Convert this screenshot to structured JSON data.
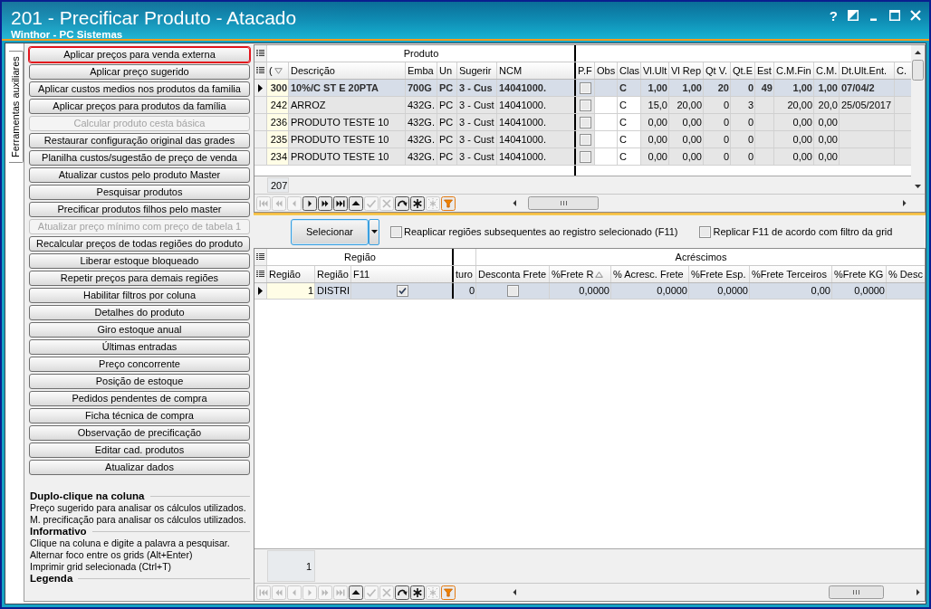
{
  "window": {
    "title": "201 - Precificar Produto - Atacado",
    "subtitle": "Winthor - PC Sistemas",
    "help_label": "?"
  },
  "side_tabs": [
    {
      "label": "Ferramentas auxiliares",
      "selected": true
    }
  ],
  "tool_buttons": [
    {
      "label": "Aplicar preços para venda externa",
      "disabled": false,
      "highlighted": true
    },
    {
      "label": "Aplicar preço sugerido",
      "disabled": false,
      "highlighted": false
    },
    {
      "label": "Aplicar custos medios nos produtos da familia",
      "disabled": false,
      "highlighted": false
    },
    {
      "label": "Aplicar preços para produtos da família",
      "disabled": false,
      "highlighted": false
    },
    {
      "label": "Calcular produto cesta básica",
      "disabled": true,
      "highlighted": false
    },
    {
      "label": "Restaurar configuração original das grades",
      "disabled": false,
      "highlighted": false
    },
    {
      "label": "Planilha custos/sugestão de preço de venda",
      "disabled": false,
      "highlighted": false
    },
    {
      "label": "Atualizar custos pelo produto Master",
      "disabled": false,
      "highlighted": false
    },
    {
      "label": "Pesquisar produtos",
      "disabled": false,
      "highlighted": false
    },
    {
      "label": "Precificar produtos filhos pelo master",
      "disabled": false,
      "highlighted": false
    },
    {
      "label": "Atualizar preço mínimo com preço de tabela 1",
      "disabled": true,
      "highlighted": false
    },
    {
      "label": "Recalcular preços de todas regiões do produto",
      "disabled": false,
      "highlighted": false
    },
    {
      "label": "Liberar estoque bloqueado",
      "disabled": false,
      "highlighted": false
    },
    {
      "label": "Repetir preços para demais regiões",
      "disabled": false,
      "highlighted": false
    },
    {
      "label": "Habilitar filtros por coluna",
      "disabled": false,
      "highlighted": false
    },
    {
      "label": "Detalhes do produto",
      "disabled": false,
      "highlighted": false
    },
    {
      "label": "Giro estoque anual",
      "disabled": false,
      "highlighted": false
    },
    {
      "label": "Últimas entradas",
      "disabled": false,
      "highlighted": false
    },
    {
      "label": "Preço concorrente",
      "disabled": false,
      "highlighted": false
    },
    {
      "label": "Posição de estoque",
      "disabled": false,
      "highlighted": false
    },
    {
      "label": "Pedidos pendentes de compra",
      "disabled": false,
      "highlighted": false
    },
    {
      "label": "Ficha técnica de compra",
      "disabled": false,
      "highlighted": false
    },
    {
      "label": "Observação de precificação",
      "disabled": false,
      "highlighted": false
    },
    {
      "label": "Editar cad. produtos",
      "disabled": false,
      "highlighted": false
    },
    {
      "label": "Atualizar dados",
      "disabled": false,
      "highlighted": false
    }
  ],
  "help_sections": [
    {
      "title": "Duplo-clique na coluna",
      "lines": [
        "Preço sugerido para analisar os cálculos utilizados.",
        "M. precificação para analisar os cálculos utilizados."
      ]
    },
    {
      "title": "Informativo",
      "lines": [
        "Clique na coluna e digite a palavra a pesquisar.",
        "Alternar foco entre os grids (Alt+Enter)",
        "Imprimir grid selecionada (Ctrl+T)"
      ]
    },
    {
      "title": "Legenda"
    }
  ],
  "product_grid": {
    "bands": [
      "Produto"
    ],
    "columns": [
      {
        "label": "(",
        "kind": "code",
        "sorted_desc": true,
        "editable": false
      },
      {
        "label": "Descrição",
        "kind": "text",
        "editable": false
      },
      {
        "label": "Emba",
        "kind": "text",
        "editable": false
      },
      {
        "label": "Un",
        "kind": "text",
        "editable": false
      },
      {
        "label": "Sugerir",
        "kind": "text",
        "editable": false
      },
      {
        "label": "NCM",
        "kind": "text",
        "editable": false
      },
      {
        "label": "P.F",
        "kind": "check",
        "editable": false
      },
      {
        "label": "Obs",
        "kind": "text",
        "editable": true
      },
      {
        "label": "Clas",
        "kind": "text",
        "editable": true
      },
      {
        "label": "Vl.Ult",
        "kind": "number",
        "editable": false
      },
      {
        "label": "Vl Rep",
        "kind": "number",
        "editable": false
      },
      {
        "label": "Qt V.",
        "kind": "number",
        "editable": false
      },
      {
        "label": "Qt.E",
        "kind": "number",
        "editable": false
      },
      {
        "label": "Est",
        "kind": "number",
        "editable": false
      },
      {
        "label": "C.M.Fin",
        "kind": "number",
        "editable": false
      },
      {
        "label": "C.M.",
        "kind": "number",
        "editable": false
      },
      {
        "label": "Dt.Ult.Ent.",
        "kind": "text",
        "editable": false
      },
      {
        "label": "C.",
        "kind": "text",
        "editable": false
      }
    ],
    "rows": [
      {
        "selected": true,
        "bold": true,
        "cells": [
          "300",
          "10%/C ST E 20PTA",
          "700G",
          "PC",
          "3 - Cus",
          "14041000.",
          {
            "checked": false
          },
          null,
          "C",
          "1,00",
          "1,00",
          "20",
          "0",
          "49",
          "1,00",
          "1,00",
          "07/04/2",
          null
        ]
      },
      {
        "selected": false,
        "bold": false,
        "cells": [
          "242",
          "ARROZ",
          "432G.",
          "PC",
          "3 - Cust",
          "14041000.",
          {
            "checked": false
          },
          null,
          "C",
          "15,0",
          "20,00",
          "0",
          "3",
          null,
          "20,00",
          "20,0",
          "25/05/2017",
          null
        ]
      },
      {
        "selected": false,
        "bold": false,
        "cells": [
          "236",
          "PRODUTO TESTE 10",
          "432G.",
          "PC",
          "3 - Cust",
          "14041000.",
          {
            "checked": false
          },
          null,
          "C",
          "0,00",
          "0,00",
          "0",
          "0",
          null,
          "0,00",
          "0,00",
          null,
          null
        ]
      },
      {
        "selected": false,
        "bold": false,
        "cells": [
          "235",
          "PRODUTO TESTE 10",
          "432G.",
          "PC",
          "3 - Cust",
          "14041000.",
          {
            "checked": false
          },
          null,
          "C",
          "0,00",
          "0,00",
          "0",
          "0",
          null,
          "0,00",
          "0,00",
          null,
          null
        ]
      },
      {
        "selected": false,
        "bold": false,
        "cells": [
          "234",
          "PRODUTO TESTE 10",
          "432G.",
          "PC",
          "3 - Cust",
          "14041000.",
          {
            "checked": false
          },
          null,
          "C",
          "0,00",
          "0,00",
          "0",
          "0",
          null,
          "0,00",
          "0,00",
          null,
          null
        ]
      }
    ],
    "footer": "207",
    "navigator": [
      {
        "kind": "first",
        "disabled": true
      },
      {
        "kind": "prior_page",
        "disabled": true
      },
      {
        "kind": "prior",
        "disabled": true
      },
      {
        "kind": "next",
        "disabled": false
      },
      {
        "kind": "next_page",
        "disabled": false
      },
      {
        "kind": "last",
        "disabled": false
      },
      {
        "kind": "edit",
        "disabled": false
      },
      {
        "kind": "post",
        "disabled": true
      },
      {
        "kind": "cancel",
        "disabled": true
      },
      {
        "kind": "refresh",
        "disabled": false
      },
      {
        "kind": "bookmark",
        "disabled": false
      },
      {
        "kind": "goto_bookmark",
        "disabled": true
      },
      {
        "kind": "filter",
        "disabled": false
      }
    ]
  },
  "selector": {
    "button": "Selecionar",
    "options": [
      {
        "label": "Reaplicar regiões subsequentes ao registro selecionado (F11)",
        "checked": false
      },
      {
        "label": "Replicar F11 de acordo com filtro da grid",
        "checked": false
      }
    ]
  },
  "region_grid": {
    "bands": [
      "Região",
      "Acréscimos"
    ],
    "columns": [
      {
        "label": "Região",
        "kind": "code"
      },
      {
        "label": "Região",
        "kind": "text"
      },
      {
        "label": "F11",
        "kind": "check"
      },
      {
        "label": "turo",
        "kind": "number"
      },
      {
        "label": "Desconta Frete",
        "kind": "check"
      },
      {
        "label": "%Frete R",
        "kind": "number",
        "sorted_asc": true
      },
      {
        "label": "% Acresc. Frete",
        "kind": "number"
      },
      {
        "label": "%Frete Esp.",
        "kind": "number"
      },
      {
        "label": "%Frete Terceiros",
        "kind": "number"
      },
      {
        "label": "%Frete KG",
        "kind": "number"
      },
      {
        "label": "% Desc",
        "kind": "number"
      }
    ],
    "rows": [
      {
        "selected": true,
        "bold": false,
        "cells": [
          "1",
          "DISTRI",
          {
            "checked": true
          },
          "0",
          {
            "checked": false
          },
          "0,0000",
          "0,0000",
          "0,0000",
          "0,00",
          "0,0000",
          null
        ]
      }
    ],
    "footer": "1",
    "navigator": [
      {
        "kind": "first",
        "disabled": true
      },
      {
        "kind": "prior_page",
        "disabled": true
      },
      {
        "kind": "prior",
        "disabled": true
      },
      {
        "kind": "next",
        "disabled": true
      },
      {
        "kind": "next_page",
        "disabled": true
      },
      {
        "kind": "last",
        "disabled": true
      },
      {
        "kind": "edit",
        "disabled": false
      },
      {
        "kind": "post",
        "disabled": true
      },
      {
        "kind": "cancel",
        "disabled": true
      },
      {
        "kind": "refresh",
        "disabled": false
      },
      {
        "kind": "bookmark",
        "disabled": false
      },
      {
        "kind": "goto_bookmark",
        "disabled": true
      },
      {
        "kind": "filter",
        "disabled": false
      }
    ]
  }
}
